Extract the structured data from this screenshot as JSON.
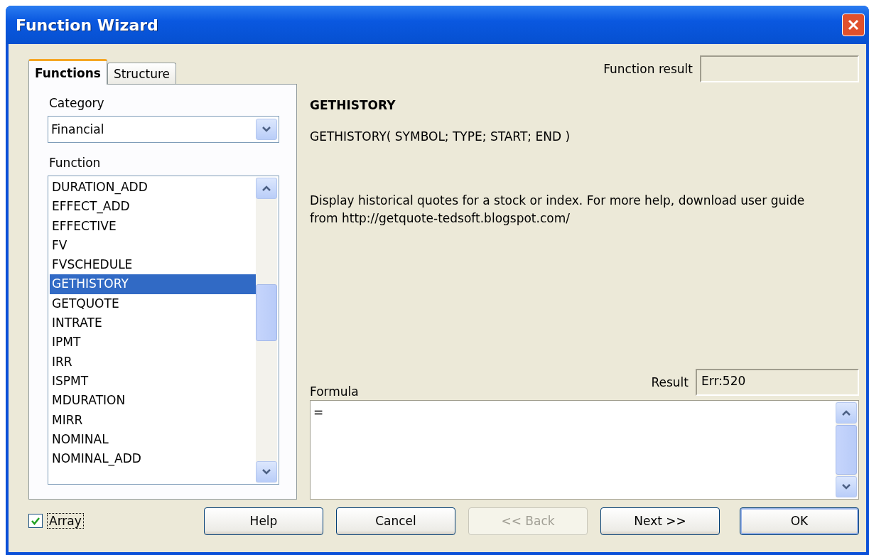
{
  "window": {
    "title": "Function Wizard"
  },
  "tabs": [
    {
      "label": "Functions",
      "selected": true
    },
    {
      "label": "Structure",
      "selected": false
    }
  ],
  "category": {
    "label": "Category",
    "value": "Financial"
  },
  "function_list": {
    "label": "Function",
    "items": [
      {
        "label": "DURATION_ADD",
        "selected": false
      },
      {
        "label": "EFFECT_ADD",
        "selected": false
      },
      {
        "label": "EFFECTIVE",
        "selected": false
      },
      {
        "label": "FV",
        "selected": false
      },
      {
        "label": "FVSCHEDULE",
        "selected": false
      },
      {
        "label": "GETHISTORY",
        "selected": true
      },
      {
        "label": "GETQUOTE",
        "selected": false
      },
      {
        "label": "INTRATE",
        "selected": false
      },
      {
        "label": "IPMT",
        "selected": false
      },
      {
        "label": "IRR",
        "selected": false
      },
      {
        "label": "ISPMT",
        "selected": false
      },
      {
        "label": "MDURATION",
        "selected": false
      },
      {
        "label": "MIRR",
        "selected": false
      },
      {
        "label": "NOMINAL",
        "selected": false
      },
      {
        "label": "NOMINAL_ADD",
        "selected": false
      }
    ]
  },
  "function_result": {
    "label": "Function result"
  },
  "function_name": "GETHISTORY",
  "syntax": "GETHISTORY( SYMBOL; TYPE; START; END )",
  "description": "Display historical quotes for a stock or index.  For more help, download user guide from http://getquote-tedsoft.blogspot.com/",
  "formula": {
    "label": "Formula",
    "value": "="
  },
  "result": {
    "label": "Result",
    "value": "Err:520"
  },
  "array": {
    "label": "Array",
    "checked": true
  },
  "buttons": [
    {
      "label": "Help",
      "disabled": false,
      "default": false
    },
    {
      "label": "Cancel",
      "disabled": false,
      "default": false
    },
    {
      "label": "<< Back",
      "disabled": true,
      "default": false
    },
    {
      "label": "Next >>",
      "disabled": false,
      "default": false
    },
    {
      "label": "OK",
      "disabled": false,
      "default": true
    }
  ]
}
